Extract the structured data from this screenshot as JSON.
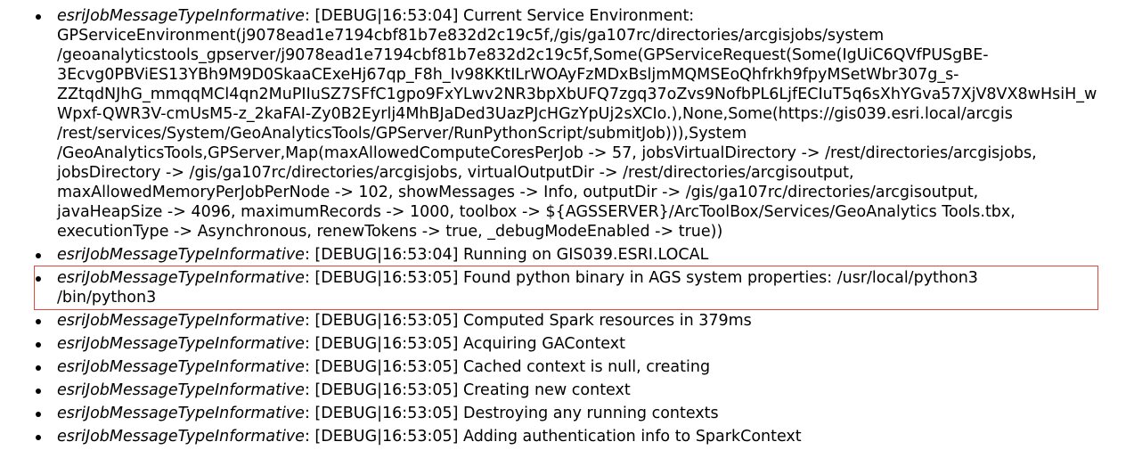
{
  "log": {
    "entries": [
      {
        "type": "esriJobMessageTypeInformative",
        "lines": [
          ": [DEBUG|16:53:04] Current Service Environment:",
          "GPServiceEnvironment(j9078ead1e7194cbf81b7e832d2c19c5f,/gis/ga107rc/directories/arcgisjobs/system",
          "/geoanalyticstools_gpserver/j9078ead1e7194cbf81b7e832d2c19c5f,Some(GPServiceRequest(Some(IgUiC6QVfPUSgBE-",
          "3Ecvg0PBViES13YBh9M9D0SkaaCExeHj67qp_F8h_Iv98KKtILrWOAyFzMDxBsljmMQMSEoQhfrkh9fpyMSetWbr307g_s-",
          "ZZtqdNJhG_mmqqMCl4qn2MuPIIuSZ7SFfC1gpo9FxYLwv2NR3bpXbUFQ7zgq37oZvs9NofbPL6LjfECIuT5q6sXhYGva57XjV8VX8wHsiH_w",
          "Wpxf-QWR3V-cmUsM5-z_2kaFAI-Zy0B2Eyrlj4MhBJaDed3UazPJcHGzYpUj2sXCIo.),None,Some(https://gis039.esri.local/arcgis",
          "/rest/services/System/GeoAnalyticsTools/GPServer/RunPythonScript/submitJob))),System",
          "/GeoAnalyticsTools,GPServer,Map(maxAllowedComputeCoresPerJob -> 57, jobsVirtualDirectory -> /rest/directories/arcgisjobs,",
          "jobsDirectory -> /gis/ga107rc/directories/arcgisjobs, virtualOutputDir -> /rest/directories/arcgisoutput,",
          "maxAllowedMemoryPerJobPerNode -> 102, showMessages -> Info, outputDir -> /gis/ga107rc/directories/arcgisoutput,",
          "javaHeapSize -> 4096, maximumRecords -> 1000, toolbox -> ${AGSSERVER}/ArcToolBox/Services/GeoAnalytics Tools.tbx,",
          "executionType -> Asynchronous, renewTokens -> true, _debugModeEnabled -> true))"
        ]
      },
      {
        "type": "esriJobMessageTypeInformative",
        "lines": [
          ": [DEBUG|16:53:04] Running on GIS039.ESRI.LOCAL"
        ]
      },
      {
        "type": "esriJobMessageTypeInformative",
        "lines": [
          ": [DEBUG|16:53:05] Found python binary in AGS system properties: /usr/local/python3",
          "/bin/python3"
        ]
      },
      {
        "type": "esriJobMessageTypeInformative",
        "lines": [
          ": [DEBUG|16:53:05] Computed Spark resources in 379ms"
        ]
      },
      {
        "type": "esriJobMessageTypeInformative",
        "lines": [
          ": [DEBUG|16:53:05] Acquiring GAContext"
        ]
      },
      {
        "type": "esriJobMessageTypeInformative",
        "lines": [
          ": [DEBUG|16:53:05] Cached context is null, creating"
        ]
      },
      {
        "type": "esriJobMessageTypeInformative",
        "lines": [
          ": [DEBUG|16:53:05] Creating new context"
        ]
      },
      {
        "type": "esriJobMessageTypeInformative",
        "lines": [
          ": [DEBUG|16:53:05] Destroying any running contexts"
        ]
      },
      {
        "type": "esriJobMessageTypeInformative",
        "lines": [
          ": [DEBUG|16:53:05] Adding authentication info to SparkContext"
        ]
      }
    ]
  },
  "highlight": {
    "color": "#e0483c",
    "entry_index": 2
  }
}
